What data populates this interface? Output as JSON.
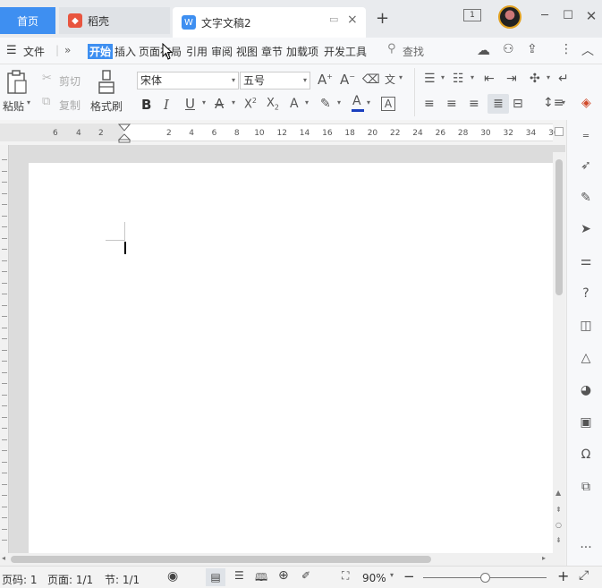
{
  "tabs": {
    "home": "首页",
    "daoke": "稻壳",
    "document": "文字文稿2"
  },
  "window": {
    "tab_count_badge": "1"
  },
  "menu": {
    "file": "文件",
    "items": [
      "开始",
      "插入",
      "页面布局",
      "引用",
      "审阅",
      "视图",
      "章节",
      "加载项",
      "开发工具"
    ],
    "search": "查找"
  },
  "ribbon": {
    "paste": "粘贴",
    "cut": "剪切",
    "copy": "复制",
    "format_painter": "格式刷",
    "font_name": "宋体",
    "font_size": "五号"
  },
  "ruler": {
    "left_marks": [
      "6",
      "4",
      "2"
    ],
    "right_marks": [
      "2",
      "4",
      "6",
      "8",
      "10",
      "12",
      "14",
      "16",
      "18",
      "20",
      "22",
      "24",
      "26",
      "28",
      "30",
      "32",
      "34",
      "36"
    ]
  },
  "status": {
    "page_code": "页码: 1",
    "page": "页面: 1/1",
    "section": "节: 1/1",
    "zoom": "90%",
    "zoom_level": 0.5
  },
  "colors": {
    "accent": "#3e8ff1",
    "font_color_bar": "#1a3fbf"
  }
}
